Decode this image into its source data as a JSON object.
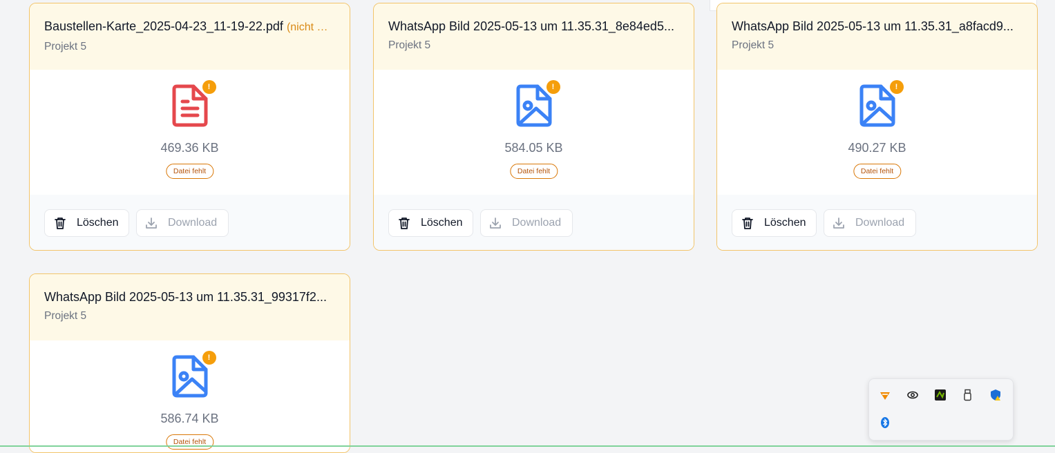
{
  "cards": [
    {
      "title": "Baustellen-Karte_2025-04-23_11-19-22.pdf",
      "title_note": "(nicht …",
      "project": "Projekt 5",
      "file_icon": "pdf-document-icon",
      "size": "469.36 KB",
      "status_badge": "Datei fehlt",
      "warning_badge": "!",
      "delete_label": "Löschen",
      "download_label": "Download"
    },
    {
      "title": "WhatsApp Bild 2025-05-13 um 11.35.31_8e84ed5...",
      "project": "Projekt 5",
      "file_icon": "image-file-icon",
      "size": "584.05 KB",
      "status_badge": "Datei fehlt",
      "warning_badge": "!",
      "delete_label": "Löschen",
      "download_label": "Download"
    },
    {
      "title": "WhatsApp Bild 2025-05-13 um 11.35.31_a8facd9...",
      "project": "Projekt 5",
      "file_icon": "image-file-icon",
      "size": "490.27 KB",
      "status_badge": "Datei fehlt",
      "warning_badge": "!",
      "delete_label": "Löschen",
      "download_label": "Download"
    },
    {
      "title": "WhatsApp Bild 2025-05-13 um 11.35.31_99317f2...",
      "project": "Projekt 5",
      "file_icon": "image-file-icon",
      "size": "586.74 KB",
      "status_badge": "Datei fehlt",
      "warning_badge": "!"
    }
  ],
  "colors": {
    "card_border": "#f2c46a",
    "card_header_bg": "#fef9e7",
    "pdf_icon": "#e5484d",
    "image_icon": "#3b82f6",
    "warning": "#f59e0b"
  },
  "system_tray": {
    "icons": [
      "vlc-icon",
      "cloud-sync-icon",
      "nvidia-icon",
      "usb-drive-icon",
      "security-shield-icon",
      "bluetooth-icon"
    ]
  }
}
